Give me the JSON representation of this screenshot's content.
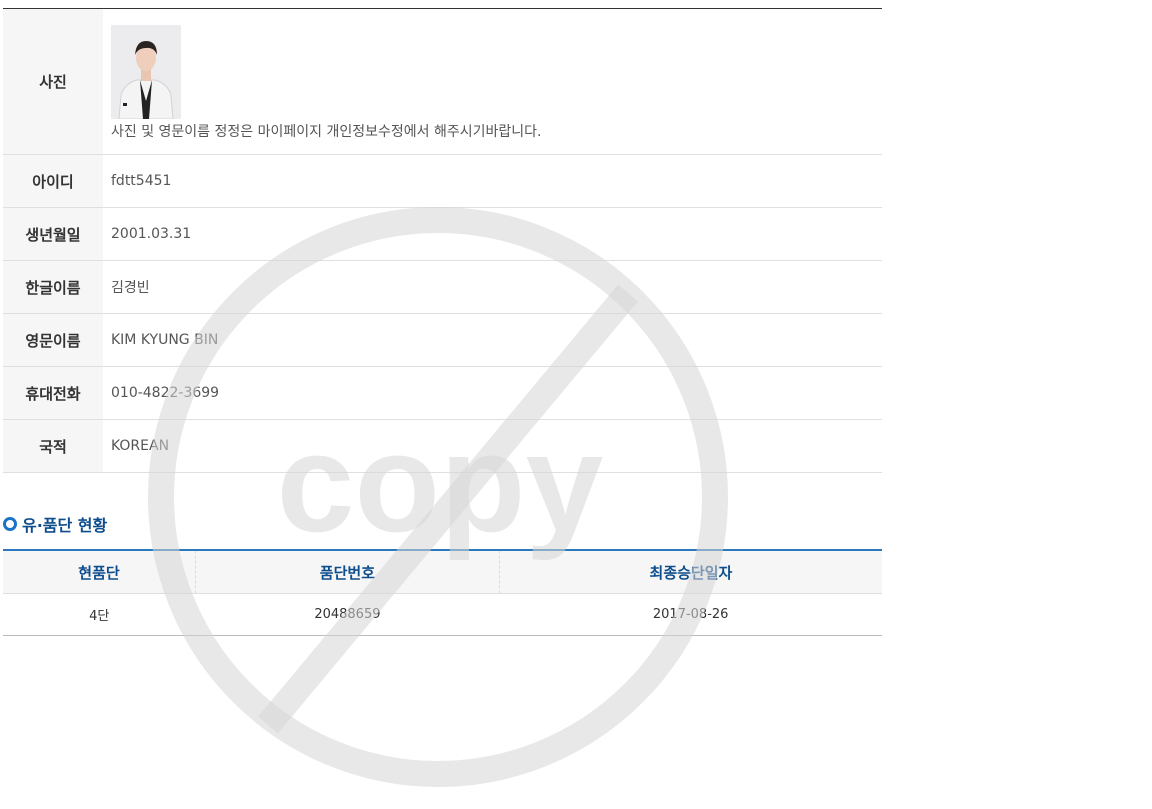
{
  "profile": {
    "photo": {
      "label": "사진",
      "note": "사진 및 영문이름 정정은 마이페이지 개인정보수정에서 해주시기바랍니다."
    },
    "rows": [
      {
        "label": "아이디",
        "value": "fdtt5451"
      },
      {
        "label": "생년월일",
        "value": "2001.03.31"
      },
      {
        "label": "한글이름",
        "value": "김경빈"
      },
      {
        "label": "영문이름",
        "value": "KIM KYUNG BIN"
      },
      {
        "label": "휴대전화",
        "value": "010-4822-3699"
      },
      {
        "label": "국적",
        "value": "KOREAN"
      }
    ]
  },
  "grade_section": {
    "title": "유·품단 현황",
    "headers": [
      "현품단",
      "품단번호",
      "최종승단일자"
    ],
    "rows": [
      [
        "4단",
        "20488659",
        "2017-08-26"
      ]
    ]
  },
  "watermark": {
    "text": "copy"
  },
  "colors": {
    "accent": "#1a73c8",
    "header_text": "#0e4d8c",
    "label_bg": "#f6f6f6"
  }
}
